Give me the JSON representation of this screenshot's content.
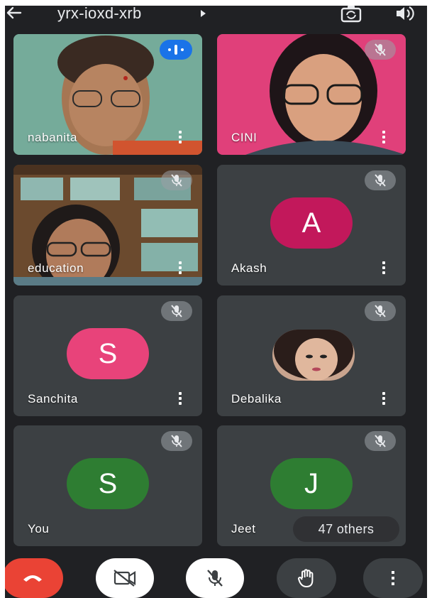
{
  "header": {
    "meeting_code": "yrx-ioxd-xrb",
    "back_icon": "arrow-left-icon",
    "caret_icon": "caret-right-icon",
    "switch_camera_icon": "switch-camera-icon",
    "speaker_icon": "speaker-icon"
  },
  "participants": [
    {
      "name": "nabanita",
      "type": "video",
      "status": "speaking"
    },
    {
      "name": "CINI",
      "type": "video",
      "status": "muted"
    },
    {
      "name": "education",
      "type": "video",
      "status": "muted"
    },
    {
      "name": "Akash",
      "type": "initial",
      "initial": "A",
      "color": "#c2185b",
      "status": "muted"
    },
    {
      "name": "Sanchita",
      "type": "initial",
      "initial": "S",
      "color": "#e8437a",
      "status": "muted"
    },
    {
      "name": "Debalika",
      "type": "photo",
      "status": "muted"
    },
    {
      "name": "You",
      "type": "initial",
      "initial": "S",
      "color": "#2e7d32",
      "status": "muted"
    },
    {
      "name": "Jeet",
      "type": "initial",
      "initial": "J",
      "color": "#2e7d32",
      "status": "muted"
    }
  ],
  "others_label": "47 others",
  "controls": {
    "end_call_icon": "phone-hangup-icon",
    "camera_icon": "camera-off-icon",
    "mic_icon": "mic-off-icon",
    "hand_icon": "raise-hand-icon",
    "more_icon": "more-vertical-icon"
  },
  "colors": {
    "background": "#202124",
    "tile": "#3c4043",
    "end_call": "#ea4335",
    "speaking": "#1a73e8"
  }
}
